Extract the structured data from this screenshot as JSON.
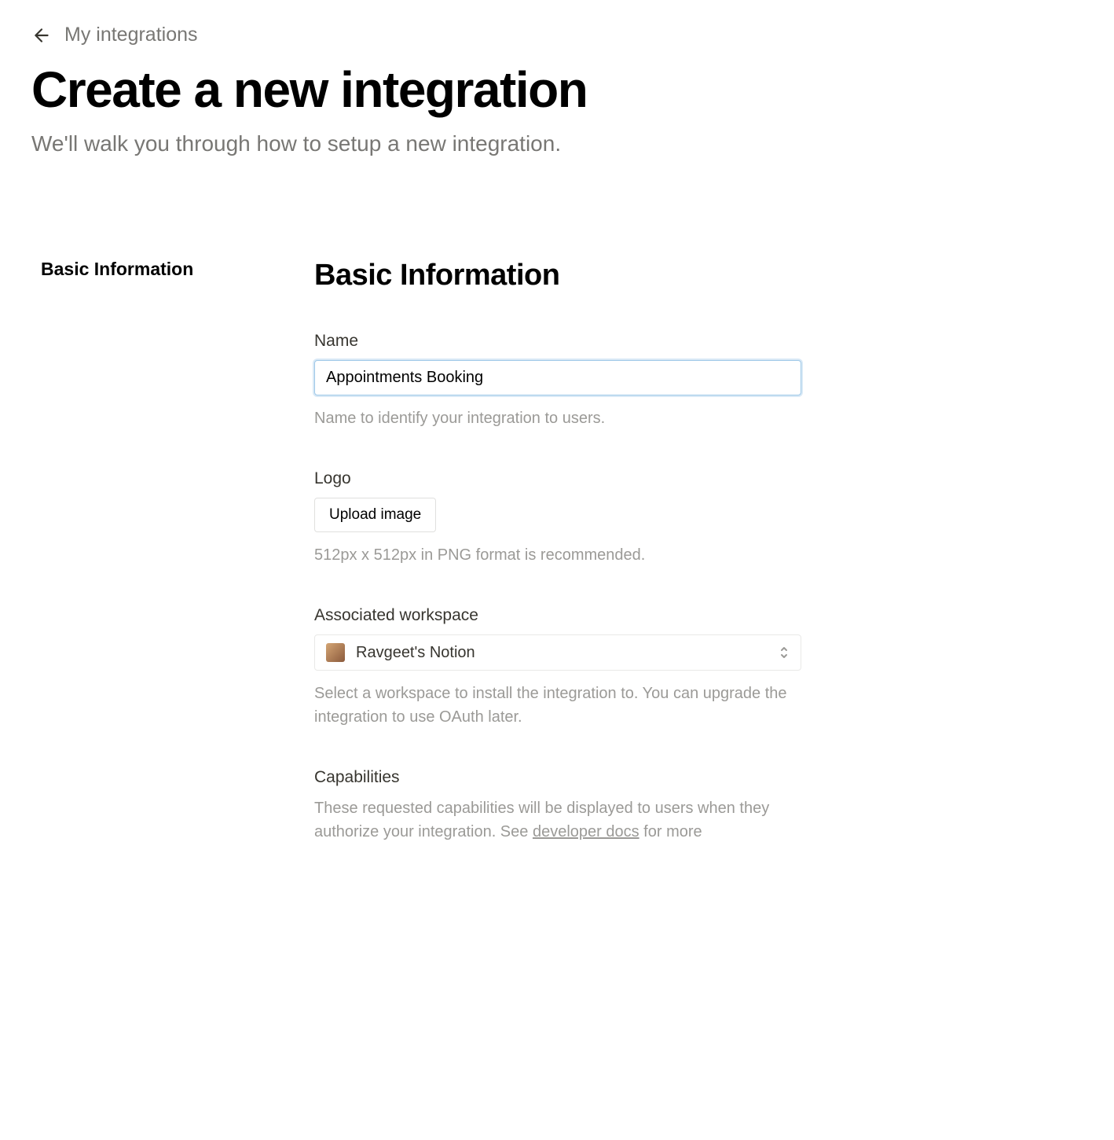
{
  "breadcrumb": {
    "label": "My integrations"
  },
  "page": {
    "title": "Create a new integration",
    "subtitle": "We'll walk you through how to setup a new integration."
  },
  "sidebar": {
    "items": [
      {
        "label": "Basic Information"
      }
    ]
  },
  "section": {
    "title": "Basic Information"
  },
  "fields": {
    "name": {
      "label": "Name",
      "value": "Appointments Booking",
      "help": "Name to identify your integration to users."
    },
    "logo": {
      "label": "Logo",
      "button": "Upload image",
      "help": "512px x 512px in PNG format is recommended."
    },
    "workspace": {
      "label": "Associated workspace",
      "value": "Ravgeet's Notion",
      "help": "Select a workspace to install the integration to. You can upgrade the integration to use OAuth later."
    },
    "capabilities": {
      "label": "Capabilities",
      "help_before": "These requested capabilities will be displayed to users when they authorize your integration. See ",
      "help_link": "developer docs",
      "help_after": " for more"
    }
  }
}
